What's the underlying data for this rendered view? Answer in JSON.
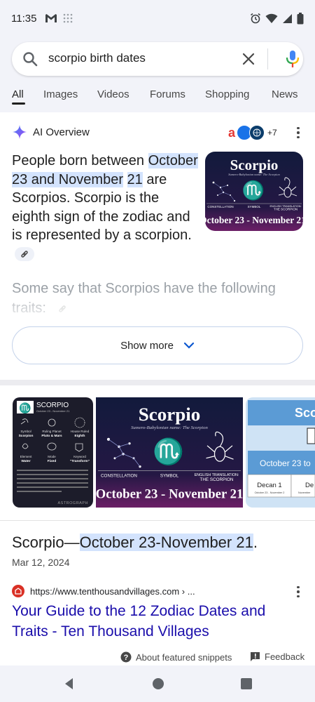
{
  "status_bar": {
    "time": "11:35",
    "left_icons": [
      "gmail-icon",
      "grid-dots-icon"
    ],
    "right_icons": [
      "alarm-icon",
      "wifi-icon",
      "signal-icon",
      "battery-icon"
    ]
  },
  "search": {
    "query": "scorpio birth dates"
  },
  "tabs": [
    {
      "label": "All",
      "active": true
    },
    {
      "label": "Images"
    },
    {
      "label": "Videos"
    },
    {
      "label": "Forums"
    },
    {
      "label": "Shopping"
    },
    {
      "label": "News"
    }
  ],
  "ai_overview": {
    "title": "AI Overview",
    "sources_more": "+7",
    "body_pre": "People born between ",
    "body_highlight_1": "October 23 and November",
    "body_highlight_2": "21",
    "body_post": " are Scorpios. Scorpio is the eighth sign of the zodiac and is represented by a scorpion.",
    "faded_text": "Some say that Scorpios have the following traits:",
    "show_more": "Show more",
    "image": {
      "title": "Scorpio",
      "subtitle": "Sumero-Babylonian name: The Scorpion",
      "label_constellation": "CONSTELLATION",
      "label_symbol": "SYMBOL",
      "label_translation_1": "ENGLISH TRANSLATION:",
      "label_translation_2": "THE SCORPION",
      "dates": "October 23 - November 21"
    }
  },
  "images": {
    "thumb1": {
      "title": "SCORPIO",
      "dates": "October 23 - November 21",
      "cells": [
        {
          "k": "Symbol",
          "v": "Scorpion"
        },
        {
          "k": "Ruling Planet",
          "v": "Pluto & Mars"
        },
        {
          "k": "House Ruled",
          "v": "Eighth"
        },
        {
          "k": "Element",
          "v": "Water"
        },
        {
          "k": "Mode",
          "v": "Fixed"
        },
        {
          "k": "Keyword",
          "v": "\"Transform\""
        }
      ],
      "brand": "ASTROGRAPH"
    },
    "thumb3": {
      "title": "Sco",
      "band": "October 23 to",
      "decan": "Decan 1",
      "decan_dates": "October 23 - November 2",
      "decan2": "De",
      "decan2_dates": "November"
    }
  },
  "snippet": {
    "title_pre": "Scorpio—",
    "title_highlight": "October 23-November 21",
    "title_post": ".",
    "date": "Mar 12, 2024"
  },
  "result": {
    "url": "https://www.tenthousandvillages.com › ...",
    "title": "Your Guide to the 12 Zodiac Dates and Traits - Ten Thousand Villages"
  },
  "footer": {
    "about": "About featured snippets",
    "feedback": "Feedback"
  },
  "colors": {
    "link": "#1a0dab",
    "highlight": "#d3e3fd",
    "zodiac_purple": "#5a1e5e",
    "zodiac_navy": "#141a3d"
  }
}
